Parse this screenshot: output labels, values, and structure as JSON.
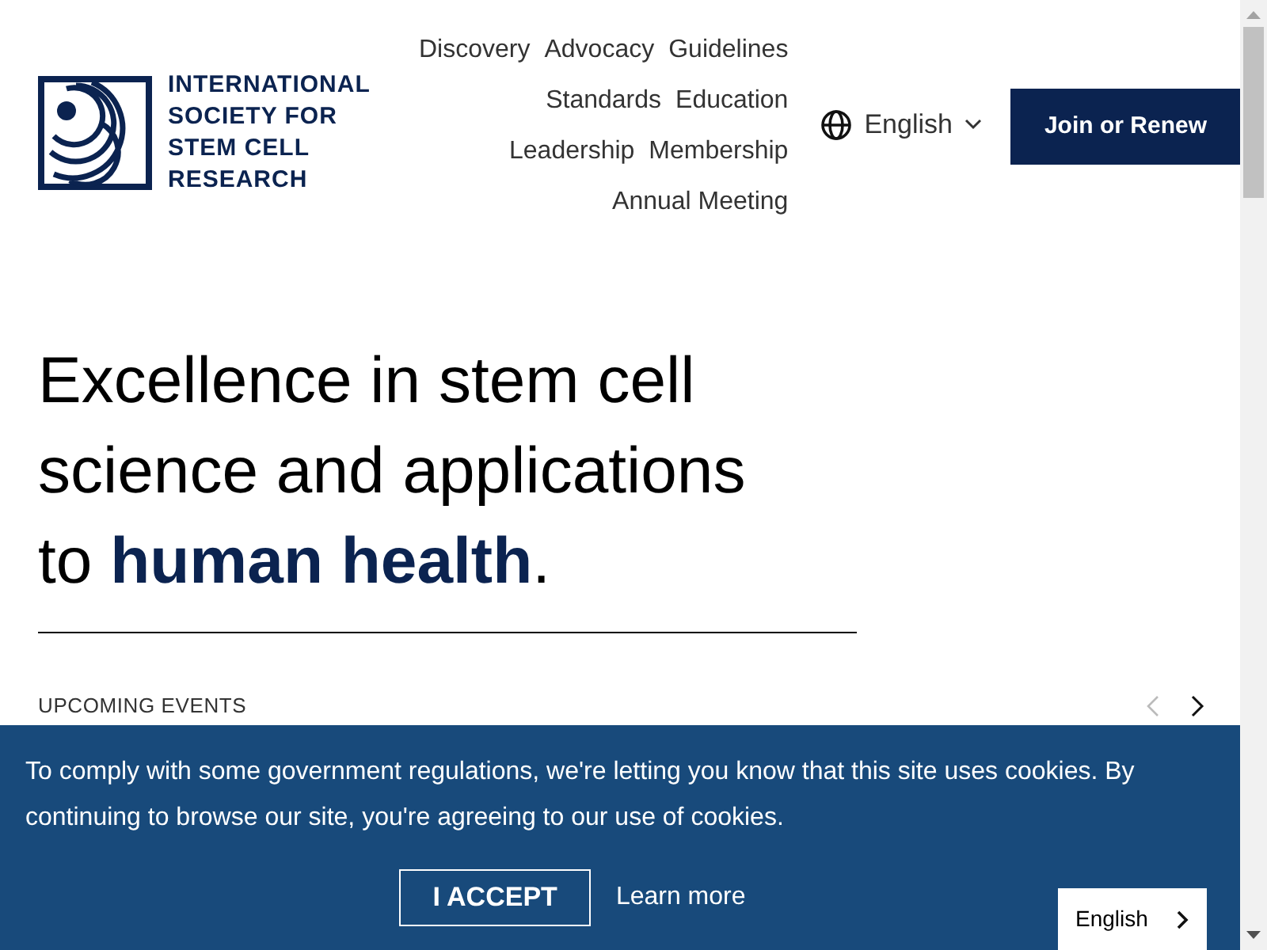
{
  "logo": {
    "lines": [
      "INTERNATIONAL",
      "SOCIETY FOR",
      "STEM CELL",
      "RESEARCH"
    ]
  },
  "nav": {
    "links": [
      "Discovery",
      "Advocacy",
      "Guidelines",
      "Standards",
      "Education",
      "Leadership",
      "Membership",
      "Annual Meeting"
    ]
  },
  "language": {
    "label": "English"
  },
  "join_button": "Join or Renew",
  "hero": {
    "headline_parts": [
      "Excellence in stem cell science and applications to ",
      "human health",
      "."
    ]
  },
  "events": {
    "heading": "UPCOMING EVENTS",
    "prev_disabled": true
  },
  "cookie_banner": {
    "text": "To comply with some government regulations, we're letting you know that this site uses cookies. By continuing to browse our site, you're agreeing to our use of cookies.",
    "accept": "I ACCEPT",
    "learn_more": "Learn more"
  },
  "language_widget": {
    "label": "English"
  }
}
